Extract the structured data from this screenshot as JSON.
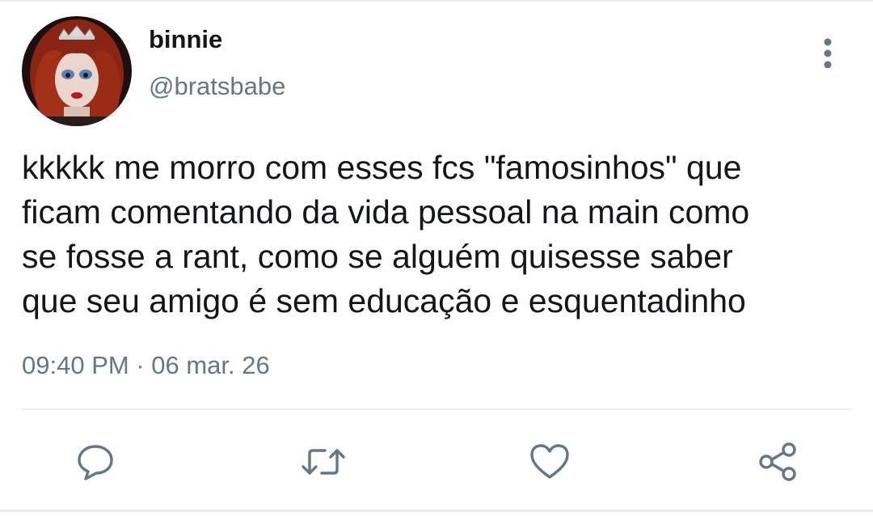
{
  "author": {
    "display_name": "binnie",
    "handle": "@bratsbabe",
    "avatar_icon": "profile-photo"
  },
  "tweet": {
    "text": "kkkkk me morro com esses fcs \"famosinhos\" que\nficam comentando da vida pessoal na main como\nse fosse a rant, como se alguém quisesse saber\nque seu amigo é sem educação e esquentadinho",
    "timestamp": "09:40 PM · 06 mar. 26"
  },
  "actions": [
    {
      "icon": "reply-icon"
    },
    {
      "icon": "retweet-icon"
    },
    {
      "icon": "like-icon"
    },
    {
      "icon": "share-icon"
    }
  ],
  "colors": {
    "text": "#14171a",
    "secondary": "#657786",
    "icon": "#657786",
    "divider": "#e6ecf0"
  }
}
